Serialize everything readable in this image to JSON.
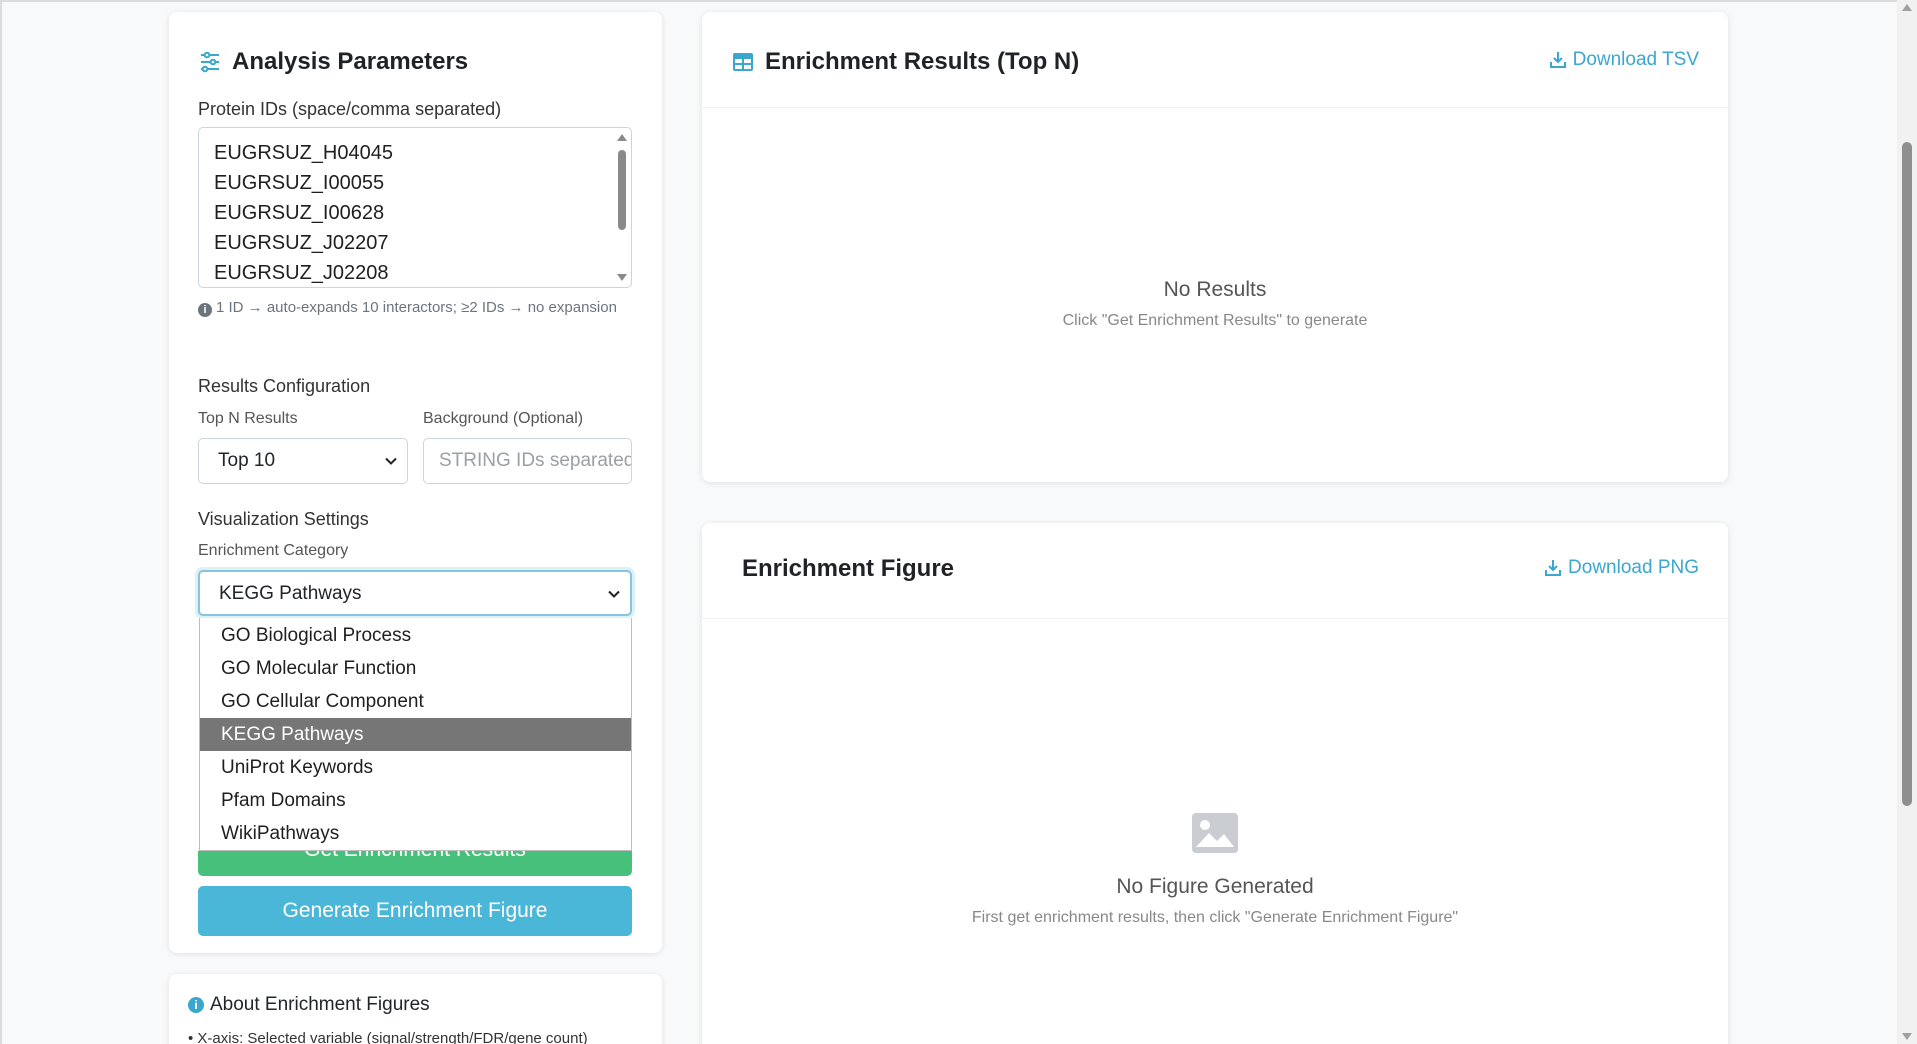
{
  "params": {
    "title": "Analysis Parameters",
    "protein_ids_label": "Protein IDs (space/comma separated)",
    "protein_ids": [
      "EUGRSUZ_H04045",
      "EUGRSUZ_I00055",
      "EUGRSUZ_I00628",
      "EUGRSUZ_J02207",
      "EUGRSUZ_J02208"
    ],
    "hint": "1 ID → auto-expands 10 interactors; ≥2 IDs → no expansion",
    "results_config_label": "Results Configuration",
    "top_n_label": "Top N Results",
    "top_n_value": "Top 10",
    "background_label": "Background (Optional)",
    "background_placeholder": "STRING IDs separated",
    "viz_settings_label": "Visualization Settings",
    "category_label": "Enrichment Category",
    "category_value": "KEGG Pathways",
    "category_options": [
      "GO Biological Process",
      "GO Molecular Function",
      "GO Cellular Component",
      "KEGG Pathways",
      "UniProt Keywords",
      "Pfam Domains",
      "WikiPathways"
    ],
    "selected_option_index": 3,
    "get_results_label": "Get Enrichment Results",
    "generate_figure_label": "Generate Enrichment Figure"
  },
  "results": {
    "title": "Enrichment Results (Top N)",
    "download_label": "Download TSV",
    "empty_title": "No Results",
    "empty_sub": "Click \"Get Enrichment Results\" to generate"
  },
  "figure": {
    "title": "Enrichment Figure",
    "download_label": "Download PNG",
    "empty_title": "No Figure Generated",
    "empty_sub": "First get enrichment results, then click \"Generate Enrichment Figure\""
  },
  "about": {
    "title": "About Enrichment Figures",
    "line1": "• X-axis: Selected variable (signal/strength/FDR/gene count)"
  },
  "colors": {
    "accent": "#3aa7cf",
    "success": "#46c07a",
    "primary_button": "#4ab7d8",
    "selected_option": "#767676"
  }
}
